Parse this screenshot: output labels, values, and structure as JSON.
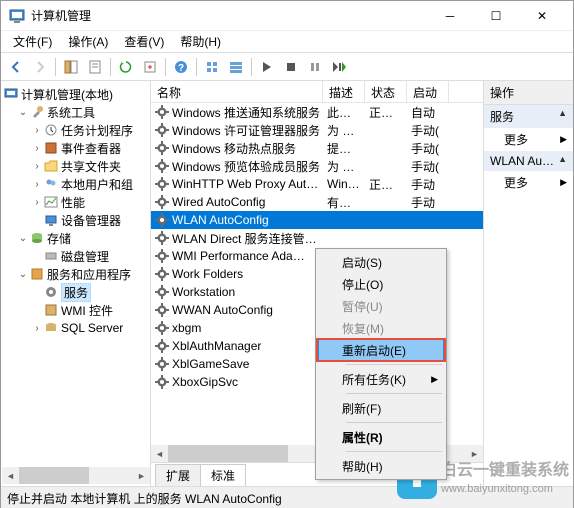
{
  "window": {
    "title": "计算机管理"
  },
  "menu": {
    "file": "文件(F)",
    "action": "操作(A)",
    "view": "查看(V)",
    "help": "帮助(H)"
  },
  "tree": {
    "root": "计算机管理(本地)",
    "system_tools": "系统工具",
    "task_scheduler": "任务计划程序",
    "event_viewer": "事件查看器",
    "shared_folders": "共享文件夹",
    "local_users": "本地用户和组",
    "performance": "性能",
    "device_manager": "设备管理器",
    "storage": "存储",
    "disk_management": "磁盘管理",
    "services_apps": "服务和应用程序",
    "services": "服务",
    "wmi": "WMI 控件",
    "sql_server": "SQL Server"
  },
  "columns": {
    "name": "名称",
    "desc": "描述",
    "status": "状态",
    "startup": "启动"
  },
  "services_list": [
    {
      "name": "Windows 推送通知系统服务",
      "desc": "此服…",
      "status": "正在…",
      "startup": "自动"
    },
    {
      "name": "Windows 许可证管理器服务",
      "desc": "为 M…",
      "status": "",
      "startup": "手动("
    },
    {
      "name": "Windows 移动热点服务",
      "desc": "提供…",
      "status": "",
      "startup": "手动("
    },
    {
      "name": "Windows 预览体验成员服务",
      "desc": "为 W…",
      "status": "",
      "startup": "手动("
    },
    {
      "name": "WinHTTP Web Proxy Aut…",
      "desc": "Win…",
      "status": "正在…",
      "startup": "手动"
    },
    {
      "name": "Wired AutoConfig",
      "desc": "有线…",
      "status": "",
      "startup": "手动"
    },
    {
      "name": "WLAN AutoConfig",
      "desc": "",
      "status": "",
      "startup": ""
    },
    {
      "name": "WLAN Direct 服务连接管…",
      "desc": "",
      "status": "",
      "startup": ""
    },
    {
      "name": "WMI Performance Ada…",
      "desc": "",
      "status": "",
      "startup": ""
    },
    {
      "name": "Work Folders",
      "desc": "",
      "status": "",
      "startup": ""
    },
    {
      "name": "Workstation",
      "desc": "",
      "status": "",
      "startup": ""
    },
    {
      "name": "WWAN AutoConfig",
      "desc": "",
      "status": "",
      "startup": ""
    },
    {
      "name": "xbgm",
      "desc": "",
      "status": "",
      "startup": ""
    },
    {
      "name": "XblAuthManager",
      "desc": "",
      "status": "",
      "startup": ""
    },
    {
      "name": "XblGameSave",
      "desc": "",
      "status": "",
      "startup": ""
    },
    {
      "name": "XboxGipSvc",
      "desc": "",
      "status": "",
      "startup": ""
    }
  ],
  "selected_index": 6,
  "tabs": {
    "extended": "扩展",
    "standard": "标准"
  },
  "actions": {
    "header": "操作",
    "section1": "服务",
    "more": "更多",
    "section2": "WLAN Au…"
  },
  "context_menu": {
    "start": "启动(S)",
    "stop": "停止(O)",
    "pause": "暂停(U)",
    "resume": "恢复(M)",
    "restart": "重新启动(E)",
    "all_tasks": "所有任务(K)",
    "refresh": "刷新(F)",
    "properties": "属性(R)",
    "help": "帮助(H)"
  },
  "statusbar": "停止并启动 本地计算机 上的服务 WLAN AutoConfig",
  "watermark": {
    "brand": "白云一键重装系统",
    "url": "www.baiyunxitong.com"
  }
}
